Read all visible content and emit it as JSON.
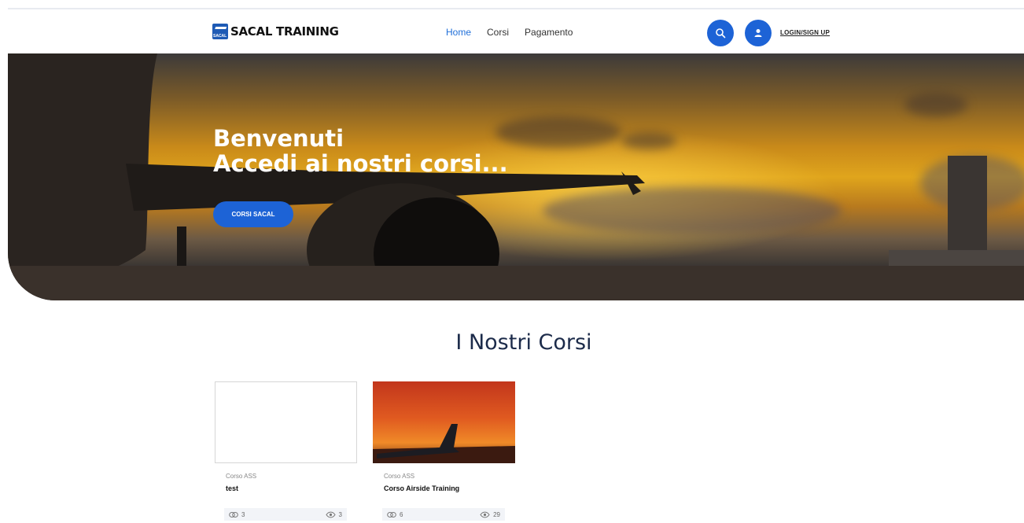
{
  "header": {
    "brand": "SACAL TRAINING",
    "logo_mark_text": "SACAL",
    "nav": [
      {
        "label": "Home",
        "active": true
      },
      {
        "label": "Corsi",
        "active": false
      },
      {
        "label": "Pagamento",
        "active": false
      }
    ],
    "login_label": "LOGIN/SIGN UP",
    "search_icon": "search-icon",
    "user_icon": "user-icon"
  },
  "hero": {
    "title_line1": "Benvenuti",
    "title_line2": "Accedi ai nostri corsi...",
    "button_label": "CORSI SACAL"
  },
  "courses_section": {
    "title": "I Nostri Corsi",
    "cards": [
      {
        "category": "Corso ASS",
        "title": "test",
        "comments": "3",
        "views": "3"
      },
      {
        "category": "Corso ASS",
        "title": "Corso Airside Training",
        "comments": "6",
        "views": "29"
      }
    ]
  },
  "colors": {
    "accent": "#1d63d6",
    "nav_active": "#1f6fd9",
    "heading": "#1c2b4a"
  }
}
